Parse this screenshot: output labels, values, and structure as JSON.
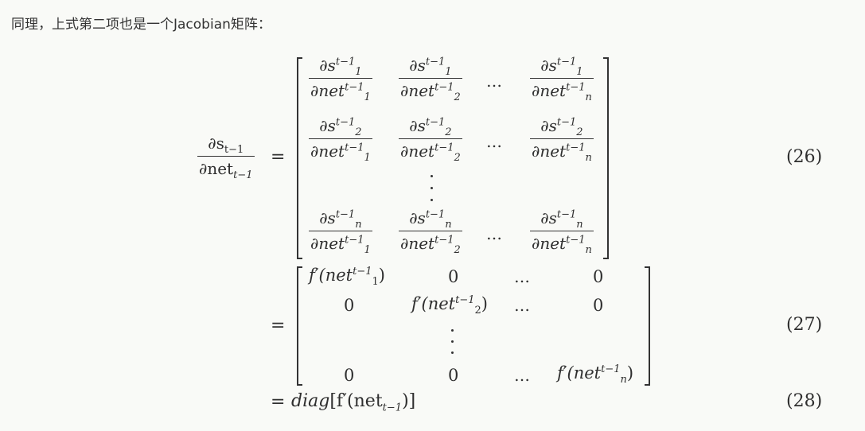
{
  "intro_text": "同理，上式第二项也是一个Jacobian矩阵：",
  "lhs": {
    "num": "∂s",
    "num_sub": "t−1",
    "den": "∂net",
    "den_sub": "t−1"
  },
  "equals": "=",
  "eq1": {
    "number": "(26)",
    "rows": [
      [
        {
          "n_base": "∂s",
          "n_sup": "t−1",
          "n_sub": "1",
          "d_base": "∂net",
          "d_sup": "t−1",
          "d_sub": "1"
        },
        {
          "n_base": "∂s",
          "n_sup": "t−1",
          "n_sub": "1",
          "d_base": "∂net",
          "d_sup": "t−1",
          "d_sub": "2"
        },
        {
          "n_base": "∂s",
          "n_sup": "t−1",
          "n_sub": "1",
          "d_base": "∂net",
          "d_sup": "t−1",
          "d_sub": "n"
        }
      ],
      [
        {
          "n_base": "∂s",
          "n_sup": "t−1",
          "n_sub": "2",
          "d_base": "∂net",
          "d_sup": "t−1",
          "d_sub": "1"
        },
        {
          "n_base": "∂s",
          "n_sup": "t−1",
          "n_sub": "2",
          "d_base": "∂net",
          "d_sup": "t−1",
          "d_sub": "2"
        },
        {
          "n_base": "∂s",
          "n_sup": "t−1",
          "n_sub": "2",
          "d_base": "∂net",
          "d_sup": "t−1",
          "d_sub": "n"
        }
      ],
      [
        {
          "n_base": "∂s",
          "n_sup": "t−1",
          "n_sub": "n",
          "d_base": "∂net",
          "d_sup": "t−1",
          "d_sub": "1"
        },
        {
          "n_base": "∂s",
          "n_sup": "t−1",
          "n_sub": "n",
          "d_base": "∂net",
          "d_sup": "t−1",
          "d_sub": "2"
        },
        {
          "n_base": "∂s",
          "n_sup": "t−1",
          "n_sub": "n",
          "d_base": "∂net",
          "d_sup": "t−1",
          "d_sub": "n"
        }
      ]
    ],
    "hdots": "…"
  },
  "eq2": {
    "number": "(27)",
    "fp": "f′(net",
    "sup": "t−1",
    "sub1": "1",
    "sub2": "2",
    "subn": "n",
    "close": ")",
    "zero": "0",
    "hdots": "…"
  },
  "eq3": {
    "number": "(28)",
    "text_a": "diag",
    "text_b": "[f′(net",
    "sub": "t−1",
    "text_c": ")]"
  }
}
